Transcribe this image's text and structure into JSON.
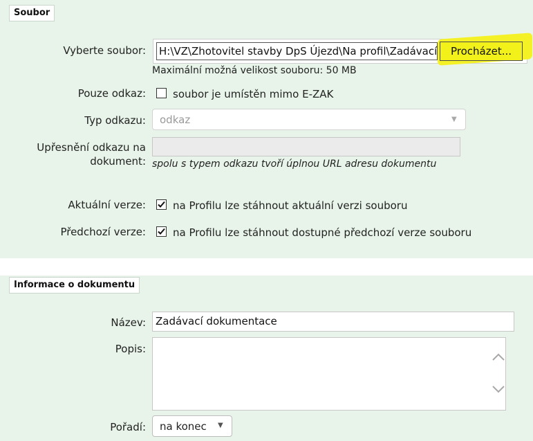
{
  "soubor_section": {
    "title": "Soubor",
    "select_file_label": "Vyberte soubor:",
    "file_path_value": "H:\\VZ\\Zhotovitel stavby DpS Újezd\\Na profil\\Zadávací",
    "browse_button": "Procházet...",
    "max_size_note": "Maximální možná velikost souboru: 50 MB",
    "link_only_label": "Pouze odkaz:",
    "link_only_checkbox_text": "soubor je umístěn mimo E-ZAK",
    "link_only_checked": false,
    "link_type_label": "Typ odkazu:",
    "link_type_value": "odkaz",
    "link_detail_label_line1": "Upřesnění odkazu na",
    "link_detail_label_line2": "dokument:",
    "link_detail_hint": "spolu s typem odkazu tvoří úplnou URL adresu dokumentu",
    "current_version_label": "Aktuální verze:",
    "current_version_text": "na Profilu lze stáhnout aktuální verzi souboru",
    "current_version_checked": true,
    "previous_version_label": "Předchozí verze:",
    "previous_version_text": "na Profilu lze stáhnout dostupné předchozí verze souboru",
    "previous_version_checked": true
  },
  "document_section": {
    "title": "Informace o dokumentu",
    "name_label": "Název:",
    "name_value": "Zadávací dokumentace",
    "description_label": "Popis:",
    "description_value": "",
    "order_label": "Pořadí:",
    "order_value": "na konec"
  },
  "colors": {
    "panel_background": "#e8f4ea",
    "highlight": "#f2f21a"
  },
  "icons": {
    "dropdown": "caret-down-icon",
    "scroll_up": "chevron-up-icon",
    "scroll_down": "chevron-down-icon",
    "check": "check-icon"
  }
}
